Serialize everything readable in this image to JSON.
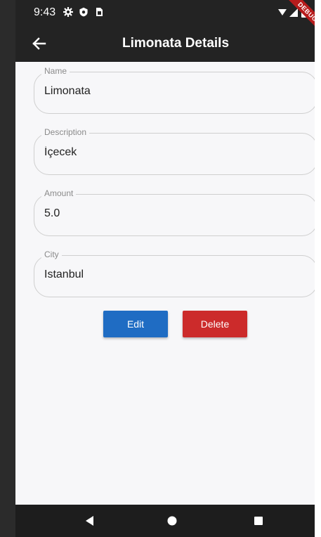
{
  "status_bar": {
    "time": "9:43"
  },
  "app_bar": {
    "title": "Limonata Details",
    "debug_label": "DEBUG"
  },
  "fields": [
    {
      "label": "Name",
      "value": "Limonata"
    },
    {
      "label": "Description",
      "value": "İçecek"
    },
    {
      "label": "Amount",
      "value": "5.0"
    },
    {
      "label": "City",
      "value": "Istanbul"
    }
  ],
  "actions": {
    "edit_label": "Edit",
    "delete_label": "Delete"
  },
  "colors": {
    "app_bar": "#232323",
    "edit_button": "#1f6cc3",
    "delete_button": "#cc2b2b",
    "background": "#f7f7f9"
  },
  "icons": {
    "back": "arrow-back-icon",
    "nav_back": "triangle-back-icon",
    "nav_home": "circle-home-icon",
    "nav_recents": "square-recents-icon"
  }
}
